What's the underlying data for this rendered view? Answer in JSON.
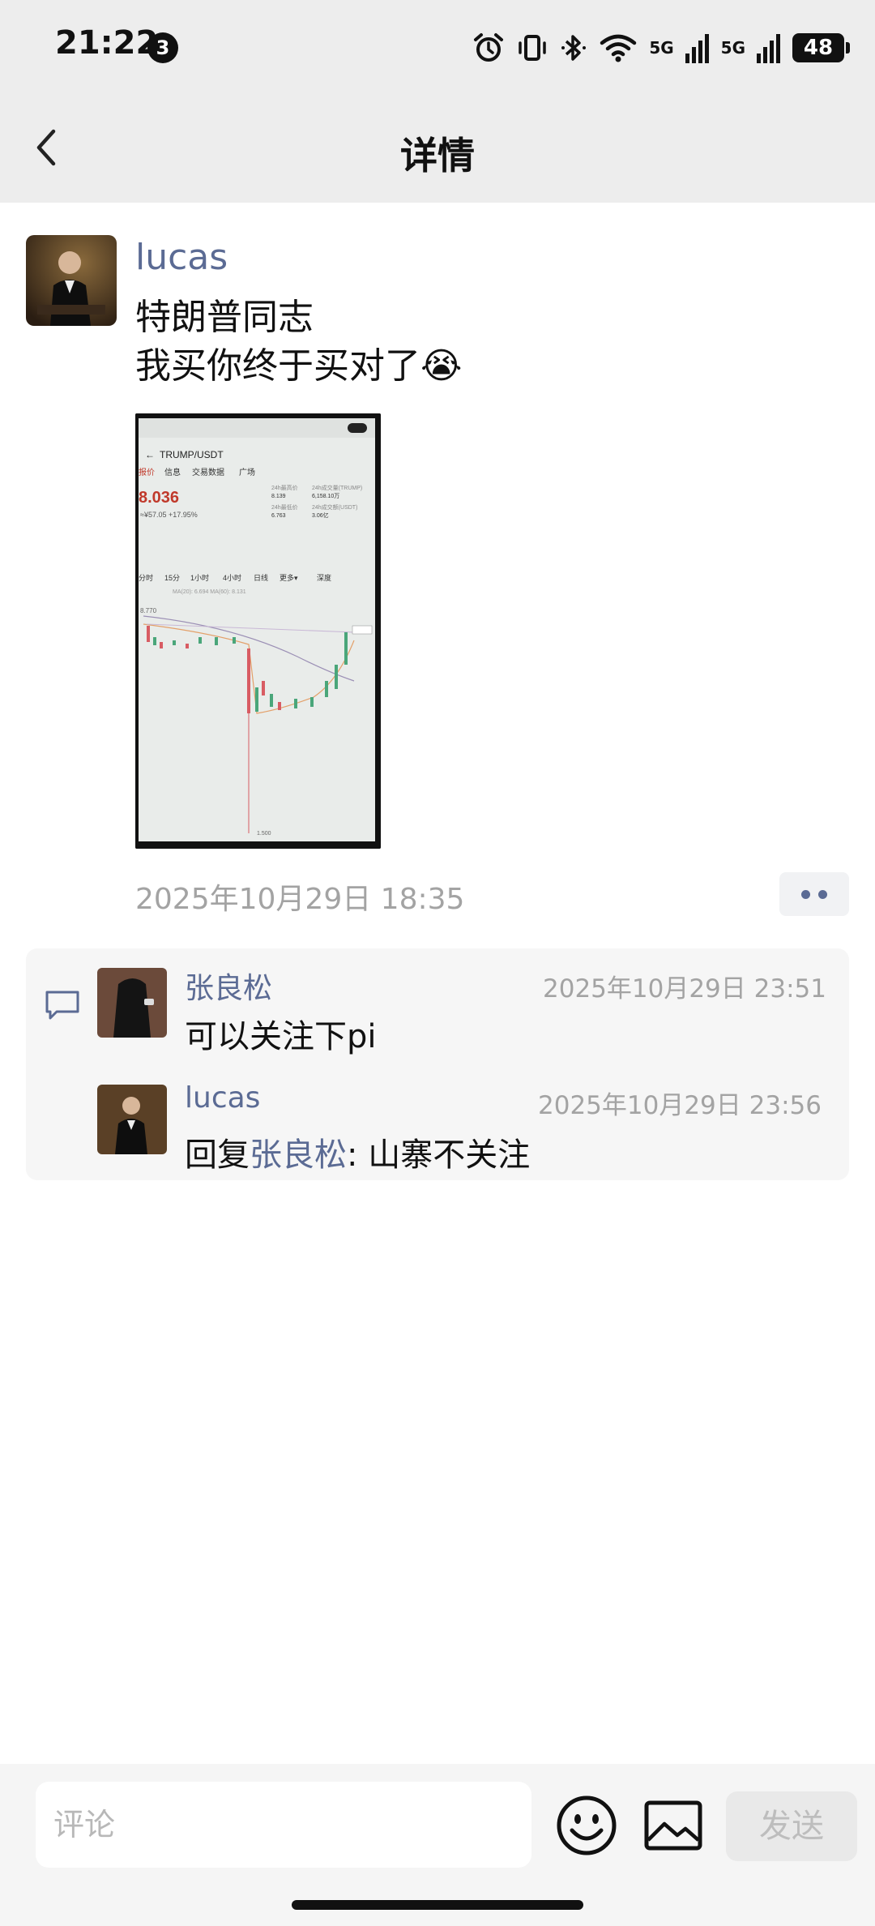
{
  "status_bar": {
    "time": "21:22",
    "notification_count": "3",
    "network_label_1": "5G",
    "network_label_2": "5G",
    "battery": "48"
  },
  "header": {
    "title": "详情"
  },
  "post": {
    "author": "lucas",
    "text": "特朗普同志\n我买你终于买对了😭",
    "timestamp": "2025年10月29日 18:35",
    "image": {
      "symbol": "TRUMP/USDT",
      "tabs": [
        "报价",
        "信息",
        "交易数据",
        "广场"
      ],
      "price": "8.036",
      "sub_price": "≈¥57.05  +17.95%",
      "stats": [
        {
          "label": "24h最高价",
          "value": "8.139"
        },
        {
          "label": "24h成交量(TRUMP)",
          "value": "6,158.10万"
        },
        {
          "label": "24h最低价",
          "value": "6.763"
        },
        {
          "label": "24h成交额(USDT)",
          "value": "3.06亿"
        }
      ],
      "intervals": [
        "分时",
        "15分",
        "1小时",
        "4小时",
        "日线",
        "更多▾",
        "深度"
      ],
      "ma_line": "MA(20): 6.694  MA(60): 8.131",
      "left_label": "8.770",
      "low_label": "1.500"
    }
  },
  "comments": [
    {
      "author": "张良松",
      "time": "2025年10月29日 23:51",
      "text": "可以关注下pi"
    },
    {
      "author": "lucas",
      "time": "2025年10月29日 23:56",
      "reply_prefix": "回复",
      "reply_to": "张良松",
      "text": ": 山寨不关注"
    }
  ],
  "composer": {
    "placeholder": "评论",
    "send_label": "发送"
  },
  "icons": {
    "back": "chevron-left-icon",
    "more": "more-dots-icon",
    "comment": "comment-bubble-icon",
    "emoji": "emoji-icon",
    "image": "image-icon"
  }
}
